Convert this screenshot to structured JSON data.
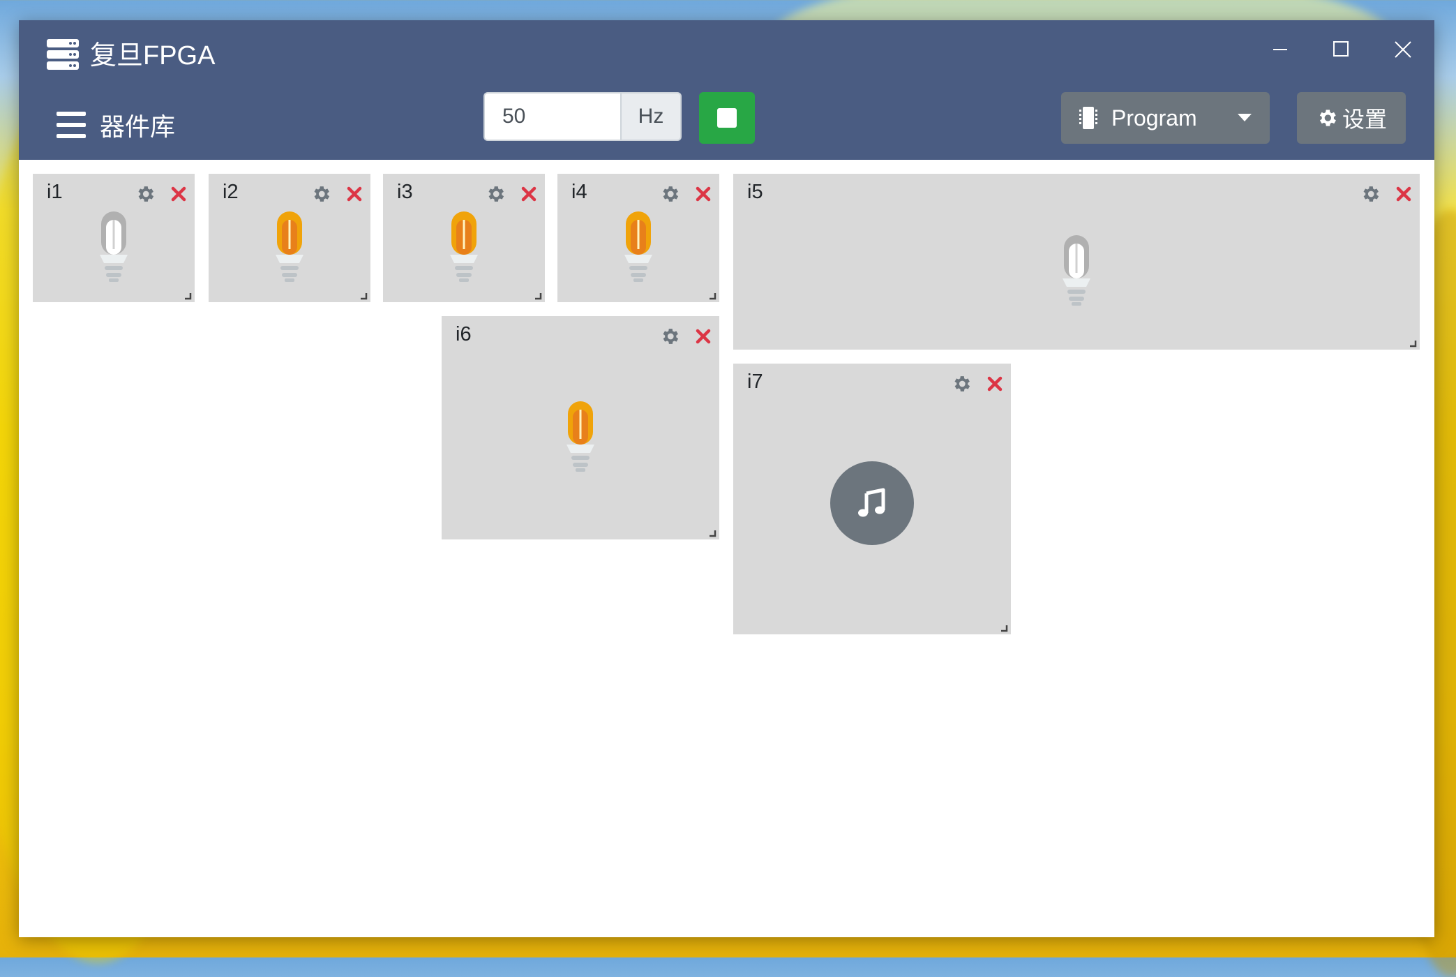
{
  "app": {
    "title": "复旦FPGA"
  },
  "toolbar": {
    "menu_label": "器件库",
    "frequency_value": "50",
    "frequency_unit": "Hz",
    "program_label": "Program",
    "settings_label": "设置"
  },
  "colors": {
    "titlebar": "#4a5c82",
    "stop_button": "#28a745",
    "secondary_button": "#6c757d",
    "card_bg": "#d9d9d9",
    "close_red": "#dc3545",
    "bulb_on": "#f0a30a",
    "bulb_off": "#b0b0b0"
  },
  "components": [
    {
      "id": "i1",
      "type": "led",
      "state": "off"
    },
    {
      "id": "i2",
      "type": "led",
      "state": "on"
    },
    {
      "id": "i3",
      "type": "led",
      "state": "on"
    },
    {
      "id": "i4",
      "type": "led",
      "state": "on"
    },
    {
      "id": "i5",
      "type": "led",
      "state": "off"
    },
    {
      "id": "i6",
      "type": "led",
      "state": "on"
    },
    {
      "id": "i7",
      "type": "buzzer",
      "icon": "music-note-icon"
    }
  ]
}
